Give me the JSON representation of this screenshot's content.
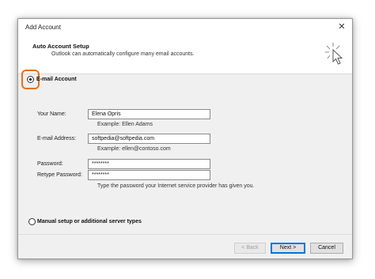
{
  "window": {
    "title": "Add Account",
    "close_glyph": "✕"
  },
  "header": {
    "title": "Auto Account Setup",
    "subtitle": "Outlook can automatically configure many email accounts.",
    "icon": "wizard-cursor-icon"
  },
  "email_account": {
    "option_label": "E-mail Account",
    "selected": true,
    "your_name": {
      "label": "Your Name:",
      "value": "Elena Opris",
      "example": "Example: Ellen Adams"
    },
    "email_address": {
      "label": "E-mail Address:",
      "value": "softpedia@softpedia.com",
      "example": "Example: ellen@contoso.com"
    },
    "password": {
      "label": "Password:",
      "value": "********"
    },
    "retype_password": {
      "label": "Retype Password:",
      "value": "********"
    },
    "password_hint": "Type the password your Internet service provider has given you."
  },
  "manual_setup": {
    "option_label": "Manual setup or additional server types",
    "selected": false
  },
  "buttons": {
    "back": "< Back",
    "next": "Next >",
    "cancel": "Cancel"
  },
  "colors": {
    "focus_highlight": "#e8711a",
    "primary_button_border": "#0078d7"
  }
}
